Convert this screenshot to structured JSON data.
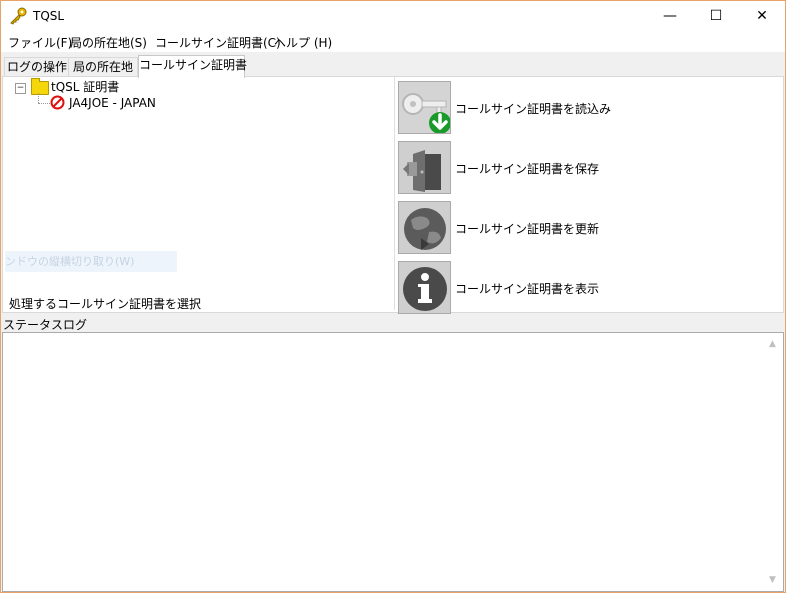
{
  "window": {
    "title": "TQSL"
  },
  "controls": {
    "minimize": "—",
    "maximize": "☐",
    "close": "✕"
  },
  "menu": [
    "ファイル(F)",
    "局の所在地(S)",
    "コールサイン証明書(C)",
    "ヘルプ (H)"
  ],
  "tabs": [
    {
      "label": "ログの操作",
      "active": false
    },
    {
      "label": "局の所在地",
      "active": false
    },
    {
      "label": "コールサイン証明書",
      "active": true
    }
  ],
  "tree": {
    "expander": "−",
    "root_label": "tQSL 証明書",
    "child_label": "JA4JOE - JAPAN"
  },
  "ghost_text": "ンドウの縦横切り取り(W)",
  "hint": "処理するコールサイン証明書を選択",
  "actions": [
    {
      "label": "コールサイン証明書を読込み",
      "icon": "key-download-icon"
    },
    {
      "label": "コールサイン証明書を保存",
      "icon": "save-door-icon"
    },
    {
      "label": "コールサイン証明書を更新",
      "icon": "globe-renew-icon"
    },
    {
      "label": "コールサイン証明書を表示",
      "icon": "info-icon"
    }
  ],
  "status": {
    "label": "ステータスログ",
    "log_text": ""
  },
  "colors": {
    "accent_border": "#e8a36b",
    "folder": "#f5d60a",
    "download_green": "#1a9a2a",
    "blocked_red": "#e01010"
  }
}
